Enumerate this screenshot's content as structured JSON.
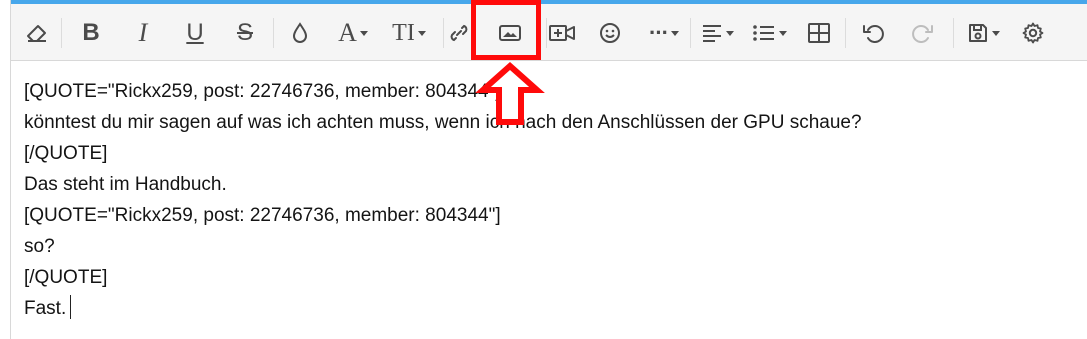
{
  "toolbar": {
    "buttons": [
      {
        "name": "remove-formatting-button",
        "icon": "eraser-icon"
      },
      {
        "name": "bold-button",
        "icon": "bold-icon",
        "glyph": "B"
      },
      {
        "name": "italic-button",
        "icon": "italic-icon",
        "glyph": "I"
      },
      {
        "name": "underline-button",
        "icon": "underline-icon",
        "glyph": "U"
      },
      {
        "name": "strikethrough-button",
        "icon": "strikethrough-icon",
        "glyph": "S"
      },
      {
        "name": "text-color-button",
        "icon": "droplet-icon"
      },
      {
        "name": "font-family-button",
        "icon": "font-icon",
        "glyph": "A"
      },
      {
        "name": "font-size-button",
        "icon": "text-size-icon",
        "glyph": "TI"
      },
      {
        "name": "insert-link-button",
        "icon": "link-icon"
      },
      {
        "name": "insert-image-button",
        "icon": "image-icon"
      },
      {
        "name": "insert-media-button",
        "icon": "video-plus-icon"
      },
      {
        "name": "insert-smilie-button",
        "icon": "smiley-icon"
      },
      {
        "name": "more-options-button",
        "icon": "ellipsis-icon",
        "glyph": "···"
      },
      {
        "name": "align-button",
        "icon": "align-left-icon"
      },
      {
        "name": "list-button",
        "icon": "list-icon"
      },
      {
        "name": "insert-table-button",
        "icon": "table-icon"
      },
      {
        "name": "undo-button",
        "icon": "undo-icon"
      },
      {
        "name": "redo-button",
        "icon": "redo-icon"
      },
      {
        "name": "drafts-button",
        "icon": "save-icon"
      },
      {
        "name": "settings-button",
        "icon": "gear-icon"
      }
    ],
    "accent_color": "#47a7eb",
    "highlight_color": "#ff0a0a"
  },
  "editor": {
    "lines": [
      "[QUOTE=\"Rickx259, post: 22746736, member: 804344\"]",
      "könntest du mir sagen auf was ich achten muss, wenn ich nach den Anschlüssen der GPU schaue?",
      "[/QUOTE]",
      "Das steht im Handbuch.",
      "[QUOTE=\"Rickx259, post: 22746736, member: 804344\"]",
      "so?",
      "[/QUOTE]",
      "Fast."
    ]
  }
}
